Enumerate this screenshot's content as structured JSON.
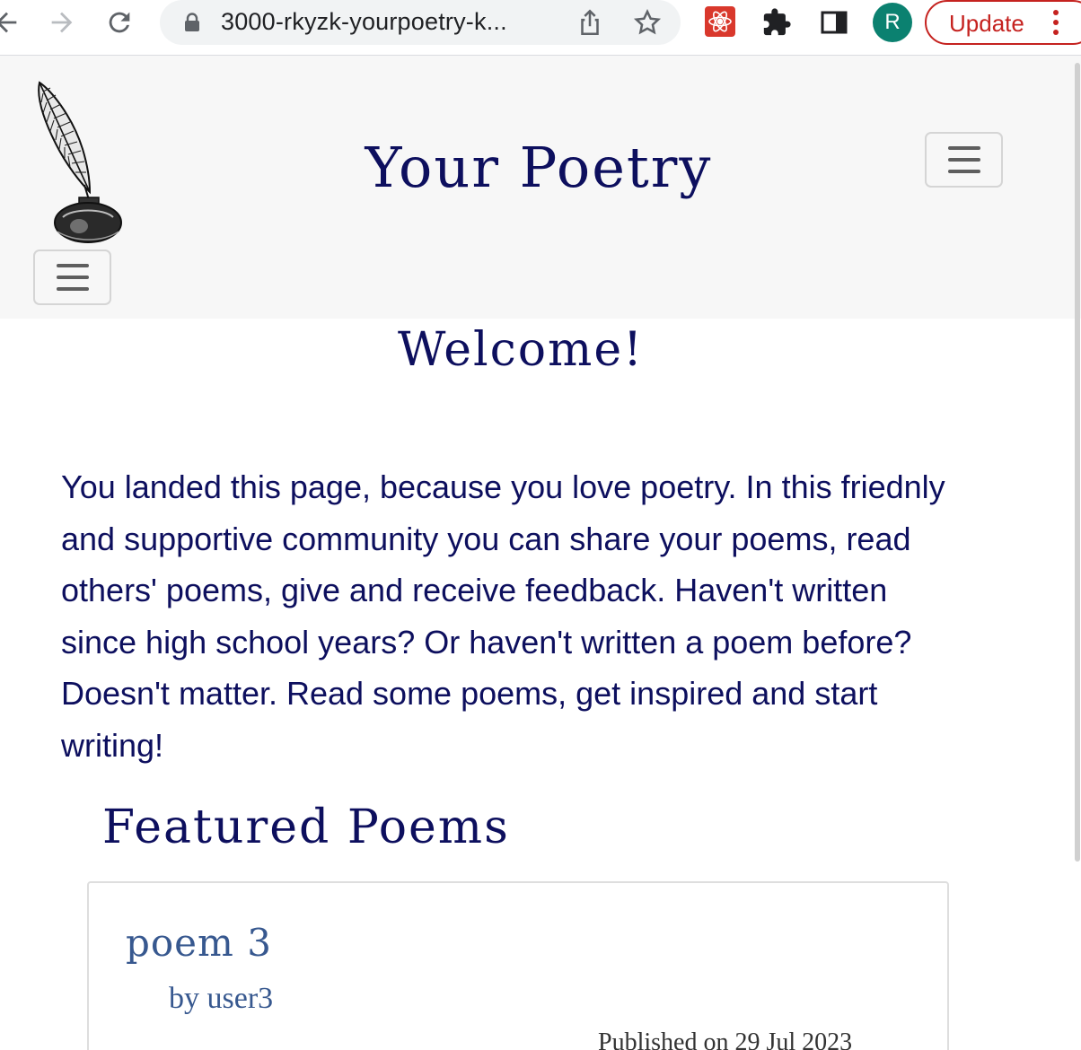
{
  "browser": {
    "url": "3000-rkyzk-yourpoetry-k...",
    "profile_initial": "R",
    "update_label": "Update",
    "colors": {
      "update": "#c5221f",
      "avatar": "#0b8170",
      "react_extension": "#d9382c"
    }
  },
  "header": {
    "site_title": "Your Poetry",
    "logo": "quill-inkwell-logo"
  },
  "main": {
    "welcome_heading": "Welcome!",
    "intro_text": "You landed this page, because you love poetry. In this friednly and supportive community you can share your poems, read others' poems, give and receive feedback. Haven't written since high school years? Or haven't written a poem before? Doesn't matter. Read some poems, get inspired and start writing!",
    "featured_heading": "Featured Poems",
    "featured_poems": [
      {
        "title": "poem 3",
        "author": "by user3",
        "published": "Published on 29 Jul 2023"
      }
    ]
  },
  "theme": {
    "heading_color": "#0d0f5e",
    "poem_link_color": "#37588f",
    "header_bg": "#f7f7f7"
  }
}
